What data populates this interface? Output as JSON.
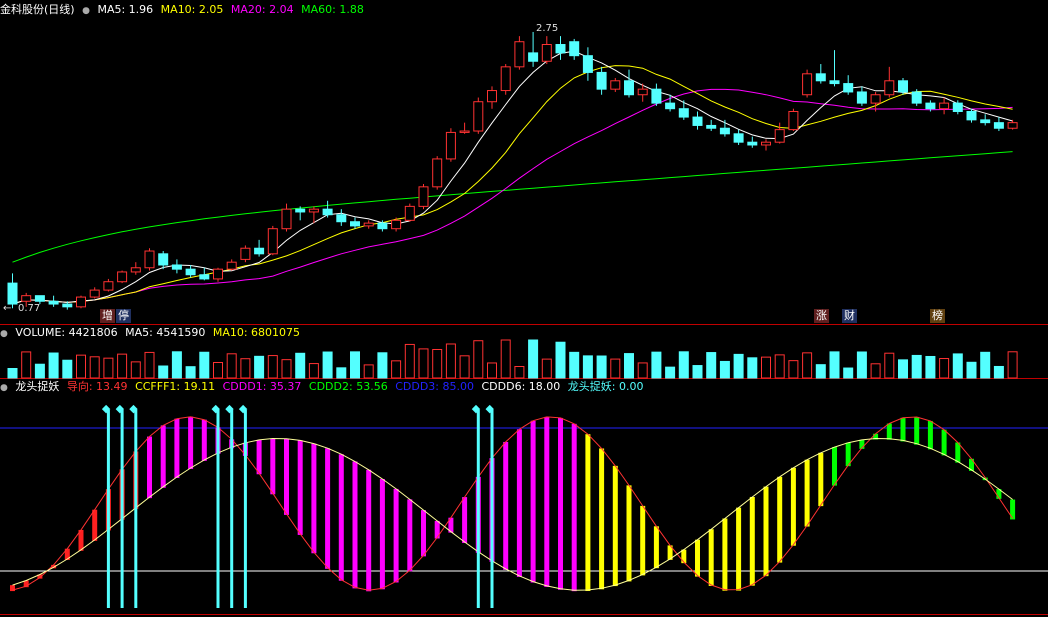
{
  "main_panel": {
    "title": "金科股份(日线)",
    "ma5": "MA5: 1.96",
    "ma10": "MA10: 2.05",
    "ma20": "MA20: 2.04",
    "ma60": "MA60: 1.88",
    "high_label": "2.75",
    "low_label": "0.77",
    "badges": [
      "增",
      "停",
      "涨",
      "财",
      "榜"
    ],
    "colors": {
      "up": "#ff3232",
      "down": "#54ffff",
      "ma5": "#ffffff",
      "ma10": "#ffff00",
      "ma20": "#ff00ff",
      "ma60": "#00ff00"
    }
  },
  "volume_panel": {
    "title": "VOLUME: 4421806",
    "ma5": "MA5: 4541590",
    "ma10": "MA10: 6801075"
  },
  "indicator_panel": {
    "title": "龙头捉妖",
    "daoxiang": "导向: 13.49",
    "ccfff1": "CCFFF1: 19.11",
    "cdddd1": "CDDD1: 35.37",
    "cdddd2": "CDDD2: 53.56",
    "cdddd3": "CDDD3: 85.00",
    "cdddd6": "CDDD6: 18.00",
    "longtou": "龙头捉妖: 0.00"
  },
  "chart_data": {
    "type": "candlestick",
    "candles": [
      [
        0.95,
        1.02,
        0.77,
        0.8
      ],
      [
        0.82,
        0.88,
        0.78,
        0.86
      ],
      [
        0.86,
        0.86,
        0.8,
        0.82
      ],
      [
        0.82,
        0.86,
        0.78,
        0.8
      ],
      [
        0.8,
        0.82,
        0.76,
        0.78
      ],
      [
        0.78,
        0.86,
        0.77,
        0.85
      ],
      [
        0.85,
        0.92,
        0.84,
        0.9
      ],
      [
        0.9,
        0.98,
        0.89,
        0.96
      ],
      [
        0.96,
        1.04,
        0.95,
        1.03
      ],
      [
        1.03,
        1.1,
        1.01,
        1.06
      ],
      [
        1.06,
        1.2,
        1.04,
        1.18
      ],
      [
        1.16,
        1.18,
        1.05,
        1.08
      ],
      [
        1.08,
        1.12,
        1.02,
        1.05
      ],
      [
        1.05,
        1.08,
        0.99,
        1.01
      ],
      [
        1.01,
        1.06,
        0.97,
        0.98
      ],
      [
        0.98,
        1.06,
        0.96,
        1.05
      ],
      [
        1.05,
        1.12,
        1.04,
        1.1
      ],
      [
        1.12,
        1.22,
        1.1,
        1.2
      ],
      [
        1.2,
        1.26,
        1.14,
        1.16
      ],
      [
        1.16,
        1.36,
        1.15,
        1.34
      ],
      [
        1.34,
        1.52,
        1.32,
        1.48
      ],
      [
        1.48,
        1.5,
        1.4,
        1.46
      ],
      [
        1.46,
        1.5,
        1.38,
        1.48
      ],
      [
        1.48,
        1.54,
        1.42,
        1.44
      ],
      [
        1.44,
        1.48,
        1.36,
        1.39
      ],
      [
        1.39,
        1.42,
        1.34,
        1.36
      ],
      [
        1.36,
        1.4,
        1.34,
        1.38
      ],
      [
        1.38,
        1.4,
        1.32,
        1.34
      ],
      [
        1.34,
        1.42,
        1.32,
        1.4
      ],
      [
        1.4,
        1.52,
        1.39,
        1.5
      ],
      [
        1.5,
        1.66,
        1.48,
        1.64
      ],
      [
        1.64,
        1.86,
        1.62,
        1.84
      ],
      [
        1.84,
        2.06,
        1.82,
        2.03
      ],
      [
        2.03,
        2.1,
        2.02,
        2.04
      ],
      [
        2.04,
        2.28,
        2.02,
        2.25
      ],
      [
        2.25,
        2.36,
        2.2,
        2.33
      ],
      [
        2.33,
        2.52,
        2.3,
        2.5
      ],
      [
        2.5,
        2.72,
        2.48,
        2.68
      ],
      [
        2.6,
        2.75,
        2.5,
        2.54
      ],
      [
        2.54,
        2.72,
        2.52,
        2.66
      ],
      [
        2.66,
        2.72,
        2.55,
        2.6
      ],
      [
        2.68,
        2.7,
        2.55,
        2.58
      ],
      [
        2.58,
        2.64,
        2.4,
        2.46
      ],
      [
        2.46,
        2.5,
        2.3,
        2.34
      ],
      [
        2.34,
        2.42,
        2.32,
        2.4
      ],
      [
        2.4,
        2.48,
        2.28,
        2.3
      ],
      [
        2.3,
        2.38,
        2.25,
        2.34
      ],
      [
        2.34,
        2.38,
        2.22,
        2.24
      ],
      [
        2.24,
        2.3,
        2.18,
        2.2
      ],
      [
        2.2,
        2.26,
        2.12,
        2.14
      ],
      [
        2.14,
        2.18,
        2.05,
        2.08
      ],
      [
        2.08,
        2.12,
        2.04,
        2.06
      ],
      [
        2.06,
        2.12,
        2.0,
        2.02
      ],
      [
        2.02,
        2.05,
        1.94,
        1.96
      ],
      [
        1.96,
        2.0,
        1.92,
        1.94
      ],
      [
        1.94,
        1.98,
        1.9,
        1.96
      ],
      [
        1.96,
        2.1,
        1.95,
        2.05
      ],
      [
        2.05,
        2.2,
        2.04,
        2.18
      ],
      [
        2.3,
        2.48,
        2.28,
        2.45
      ],
      [
        2.45,
        2.52,
        2.38,
        2.4
      ],
      [
        2.4,
        2.62,
        2.36,
        2.38
      ],
      [
        2.38,
        2.44,
        2.3,
        2.32
      ],
      [
        2.32,
        2.36,
        2.22,
        2.24
      ],
      [
        2.24,
        2.32,
        2.18,
        2.3
      ],
      [
        2.3,
        2.5,
        2.28,
        2.4
      ],
      [
        2.4,
        2.42,
        2.3,
        2.32
      ],
      [
        2.32,
        2.34,
        2.22,
        2.24
      ],
      [
        2.24,
        2.26,
        2.18,
        2.2
      ],
      [
        2.2,
        2.28,
        2.16,
        2.24
      ],
      [
        2.24,
        2.26,
        2.16,
        2.18
      ],
      [
        2.18,
        2.2,
        2.1,
        2.12
      ],
      [
        2.12,
        2.16,
        2.08,
        2.1
      ],
      [
        2.1,
        2.14,
        2.04,
        2.06
      ],
      [
        2.06,
        2.12,
        2.05,
        2.1
      ]
    ]
  }
}
